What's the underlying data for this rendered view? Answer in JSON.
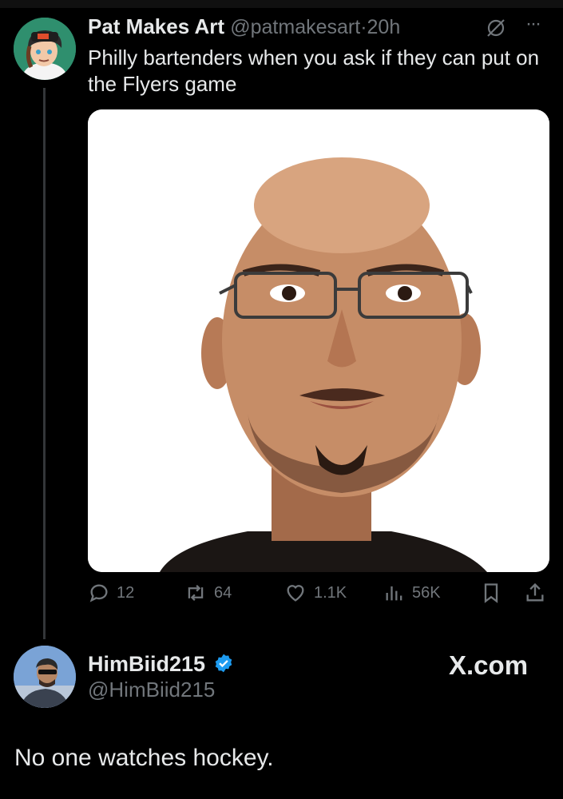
{
  "tweet": {
    "display_name": "Pat Makes Art",
    "handle": "@patmakesart",
    "separator": "·",
    "time": "20h",
    "text": "Philly bartenders when you ask if they can put on the Flyers game",
    "more_label": "···",
    "actions": {
      "replies": "12",
      "reposts": "64",
      "likes": "1.1K",
      "views": "56K"
    }
  },
  "reply": {
    "display_name": "HimBiid215",
    "handle": "@HimBiid215",
    "text": "No one watches hockey."
  },
  "watermark": "X.com",
  "colors": {
    "background": "#000000",
    "text": "#e7e9ea",
    "muted": "#71767b",
    "verified": "#1d9bf0"
  },
  "icons": [
    "grok-icon",
    "more-icon",
    "reply-icon",
    "repost-icon",
    "like-icon",
    "views-icon",
    "bookmark-icon",
    "share-icon",
    "verified-badge-icon"
  ]
}
